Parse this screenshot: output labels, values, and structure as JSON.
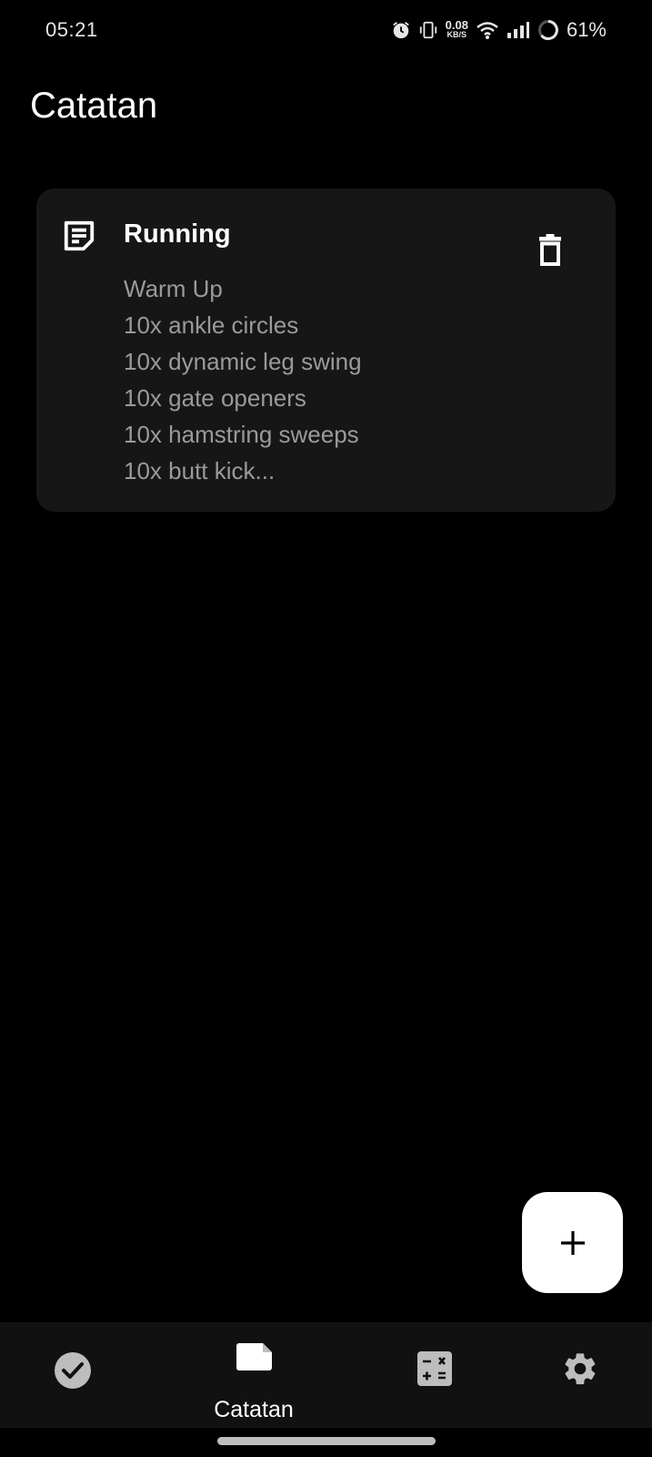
{
  "status": {
    "time": "05:21",
    "net_speed_value": "0.08",
    "net_speed_unit": "KB/S",
    "battery": "61%",
    "icons": [
      "alarm-icon",
      "vibrate-icon",
      "wifi-icon",
      "signal-icon",
      "battery-icon"
    ]
  },
  "page": {
    "title": "Catatan"
  },
  "notes": [
    {
      "title": "Running",
      "icon": "note-icon",
      "lines": [
        "Warm Up",
        "10x ankle circles",
        "10x dynamic leg swing",
        "10x gate openers",
        "10x hamstring sweeps",
        "10x butt kick..."
      ],
      "delete_icon": "trash-icon"
    }
  ],
  "fab": {
    "icon": "plus-icon"
  },
  "bottom_nav": {
    "items": [
      {
        "icon": "check-circle-icon",
        "label": ""
      },
      {
        "icon": "note-icon",
        "label": "Catatan",
        "active": true
      },
      {
        "icon": "calculator-icon",
        "label": ""
      },
      {
        "icon": "gear-icon",
        "label": ""
      }
    ]
  },
  "colors": {
    "background": "#000000",
    "card": "#161616",
    "nav_bar": "#111111",
    "text_primary": "#ffffff",
    "text_secondary": "#9a9a9a",
    "fab": "#ffffff",
    "inactive_icon": "#bdbdbd"
  }
}
